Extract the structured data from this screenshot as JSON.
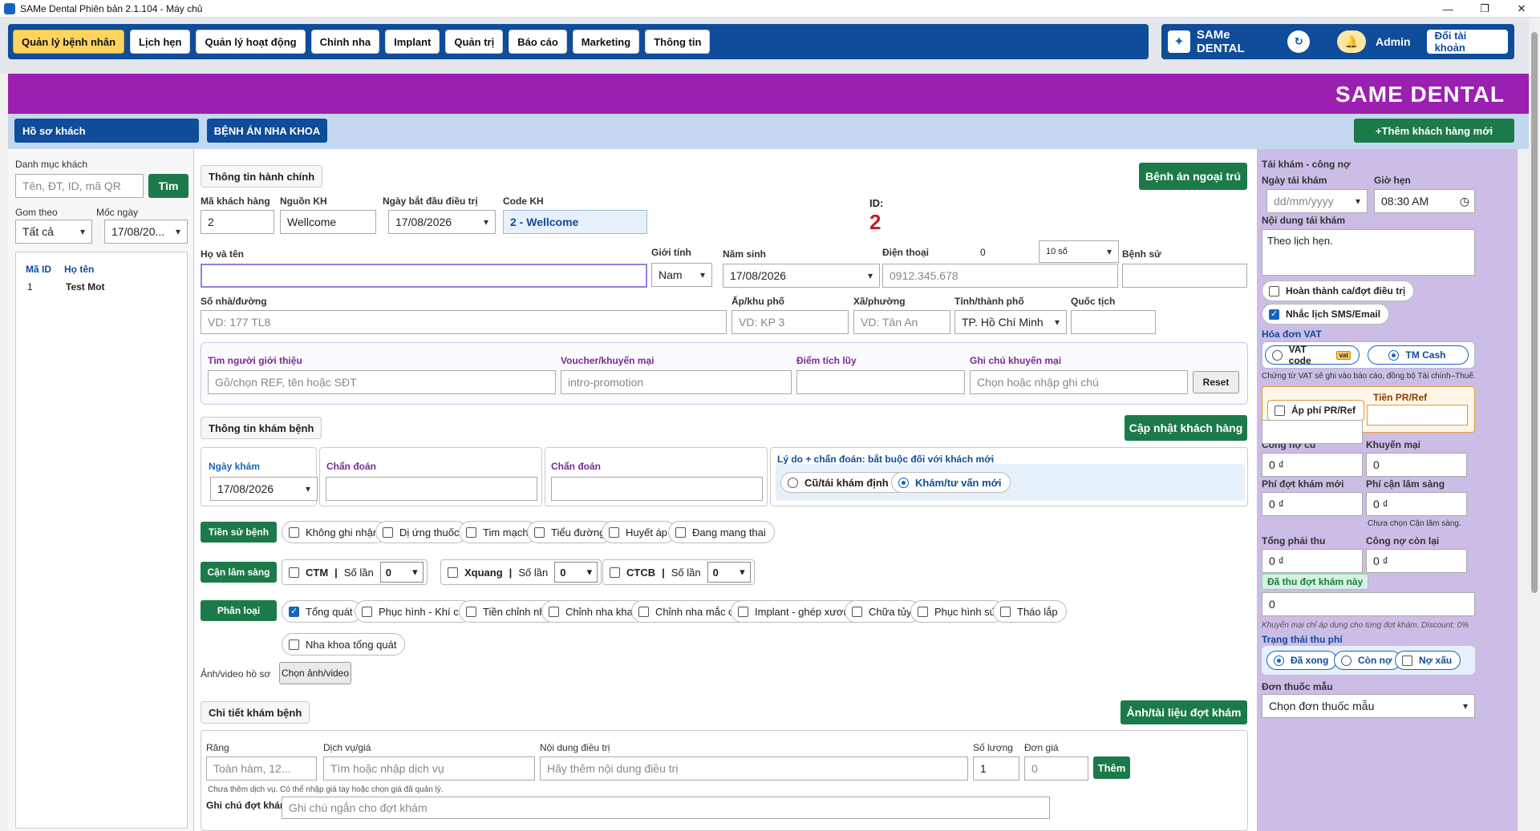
{
  "window": {
    "title": "SAMe Dental Phiên bản 2.1.104 - Máy chủ"
  },
  "menu": [
    "Quản lý bệnh nhân",
    "Lịch hẹn",
    "Quản lý hoạt động",
    "Chỉnh nha",
    "Implant",
    "Quản trị",
    "Báo cáo",
    "Marketing",
    "Thông tin"
  ],
  "brand": {
    "name": "SAMe DENTAL",
    "admin": "Admin",
    "switch": "Đổi tài khoản",
    "banner": "SAME DENTAL"
  },
  "tabs": {
    "profile": "Hồ sơ khách",
    "record": "BỆNH ÁN NHA KHOA",
    "add": "+Thêm khách hàng mới"
  },
  "left": {
    "title": "Danh mục khách",
    "search_ph": "Tên, ĐT, ID, mã QR",
    "search_btn": "Tìm",
    "group_lbl": "Gom theo",
    "group_val": "Tất cả",
    "date_lbl": "Mốc ngày",
    "date_val": "17/08/20...",
    "col_id": "Mã ID",
    "col_name": "Họ tên",
    "row_id": "1",
    "row_name": "Test Mot"
  },
  "admin": {
    "section": "Thông tin hành chính",
    "outpatient": "Bệnh án ngoại trú",
    "code_lbl": "Mã khách hàng",
    "code_val": "2",
    "src_lbl": "Nguồn KH",
    "src_val": "Wellcome",
    "start_lbl": "Ngày bắt đầu điều trị",
    "start_val": "17/08/2026",
    "kh_lbl": "Code KH",
    "kh_val": "2 - Wellcome",
    "id_lbl": "ID:",
    "id_val": "2",
    "name_lbl": "Họ và tên",
    "gender_lbl": "Giới tính",
    "gender_val": "Nam",
    "birth_lbl": "Năm sinh",
    "birth_val": "17/08/2026",
    "phone_lbl": "Điện thoại",
    "phone_count": "0",
    "phone_digits": "10 số",
    "phone_ph": "0912.345.678",
    "history_lbl": "Bệnh sử",
    "addr_lbl": "Số nhà/đường",
    "addr_ph": "VD: 177 TL8",
    "hamlet_lbl": "Ấp/khu phố",
    "hamlet_ph": "VD: KP 3",
    "ward_lbl": "Xã/phường",
    "ward_ph": "VD: Tân An",
    "city_lbl": "Tỉnh/thành phố",
    "city_val": "TP. Hồ Chí Minh",
    "nation_lbl": "Quốc tịch"
  },
  "referral": {
    "ref_lbl": "Tìm người giới thiệu",
    "ref_ph": "Gõ/chọn REF, tên hoặc SĐT",
    "voucher_lbl": "Voucher/khuyến mại",
    "voucher_ph": "intro-promotion",
    "points_lbl": "Điểm tích lũy",
    "note_lbl": "Ghi chú khuyến mại",
    "note_ph": "Chọn hoặc nhập ghi chú",
    "reset": "Reset"
  },
  "exam": {
    "section": "Thông tin khám bệnh",
    "update": "Cập nhật khách hàng",
    "date_lbl": "Ngày khám",
    "date_val": "17/08/2026",
    "diag1": "Chẩn đoán",
    "diag2": "Chẩn đoán",
    "reason_lbl": "Lý do + chẩn đoán: bắt buộc đối với khách mới",
    "reason_old": "Cũ/tái khám định kỳ",
    "reason_new": "Khám/tư vấn mới"
  },
  "history": {
    "label": "Tiền sử bệnh",
    "items": [
      "Không ghi nhận",
      "Dị ứng thuốc",
      "Tim mạch",
      "Tiểu đường",
      "Huyết áp",
      "Đang mang thai"
    ]
  },
  "clinical": {
    "label": "Cận lâm sàng",
    "items": [
      {
        "name": "CTM",
        "count_lbl": "Số lần",
        "count": "0"
      },
      {
        "name": "Xquang",
        "count_lbl": "Số lần",
        "count": "0"
      },
      {
        "name": "CTCB",
        "count_lbl": "Số lần",
        "count": "0"
      }
    ]
  },
  "category": {
    "label": "Phân loại",
    "items": [
      "Tổng quát",
      "Phục hình - Khí cụ",
      "Tiền chỉnh nha",
      "Chỉnh nha khay",
      "Chỉnh nha mắc cài",
      "Implant - ghép xương",
      "Chữa tủy",
      "Phục hình sứ",
      "Tháo lắp",
      "Nha khoa tổng quát"
    ]
  },
  "media": {
    "label": "Ảnh/video hồ sơ",
    "btn": "Chọn ảnh/video"
  },
  "detail": {
    "section": "Chi tiết khám bệnh",
    "docs": "Ảnh/tài liệu đợt khám",
    "tooth_lbl": "Răng",
    "tooth_ph": "Toàn hàm, 12...",
    "svc_lbl": "Dịch vụ/giá",
    "svc_ph": "Tìm hoặc nhập dịch vụ",
    "content_lbl": "Nội dung điều trị",
    "content_ph": "Hãy thêm nội dung điều trị",
    "qty_lbl": "Số lượng",
    "qty_val": "1",
    "price_lbl": "Đơn giá",
    "price_val": "0",
    "add": "Thêm",
    "hint": "Chưa thêm dịch vụ. Có thể nhập giá tay hoặc chọn giá đã quản lý.",
    "note_lbl": "Ghi chú đợt khám",
    "note_ph": "Ghi chú ngắn cho đợt khám"
  },
  "right": {
    "title": "Tái khám - công nợ",
    "revisit_lbl": "Ngày tái khám",
    "revisit_ph": "dd/mm/yyyy",
    "time_lbl": "Giờ hẹn",
    "time_val": "08:30 AM",
    "content_lbl": "Nội dung tái khám",
    "content_val": "Theo lịch hẹn.",
    "done": "Hoàn thành ca/đợt điều trị",
    "remind": "Nhắc lịch SMS/Email",
    "vat_title": "Hóa đơn VAT",
    "vat_code": "VAT code",
    "vat_badge": "vat",
    "tm_cash": "TM Cash",
    "vat_note": "Chứng từ VAT sẽ ghi vào báo cáo, đồng bộ Tài chính–Thuế.",
    "pr_lbl": "Áp phí PR/Ref",
    "pr_amount_lbl": "Tiền PR/Ref",
    "old_debt_lbl": "Công nợ cũ",
    "old_debt": "0 ₫",
    "promo_lbl": "Khuyến mại",
    "promo": "0",
    "new_fee_lbl": "Phí đợt khám mới",
    "new_fee": "0 ₫",
    "clinical_fee_lbl": "Phí cận lâm sàng",
    "clinical_fee": "0 ₫",
    "clinical_note": "Chưa chọn Cận lâm sàng.",
    "total_lbl": "Tổng phải thu",
    "total": "0 ₫",
    "remain_lbl": "Công nợ còn lại",
    "remain": "0 ₫",
    "paid_lbl": "Đã thu đợt khám này",
    "paid": "0",
    "promo_note": "Khuyến mại chỉ áp dụng cho từng đợt khám. Discount: 0%",
    "status_lbl": "Trạng thái thu phí",
    "st_done": "Đã xong",
    "st_debt": "Còn nợ",
    "st_bad": "Nợ xấu",
    "rx_lbl": "Đơn thuốc mẫu",
    "rx_val": "Chọn đơn thuốc mẫu"
  }
}
